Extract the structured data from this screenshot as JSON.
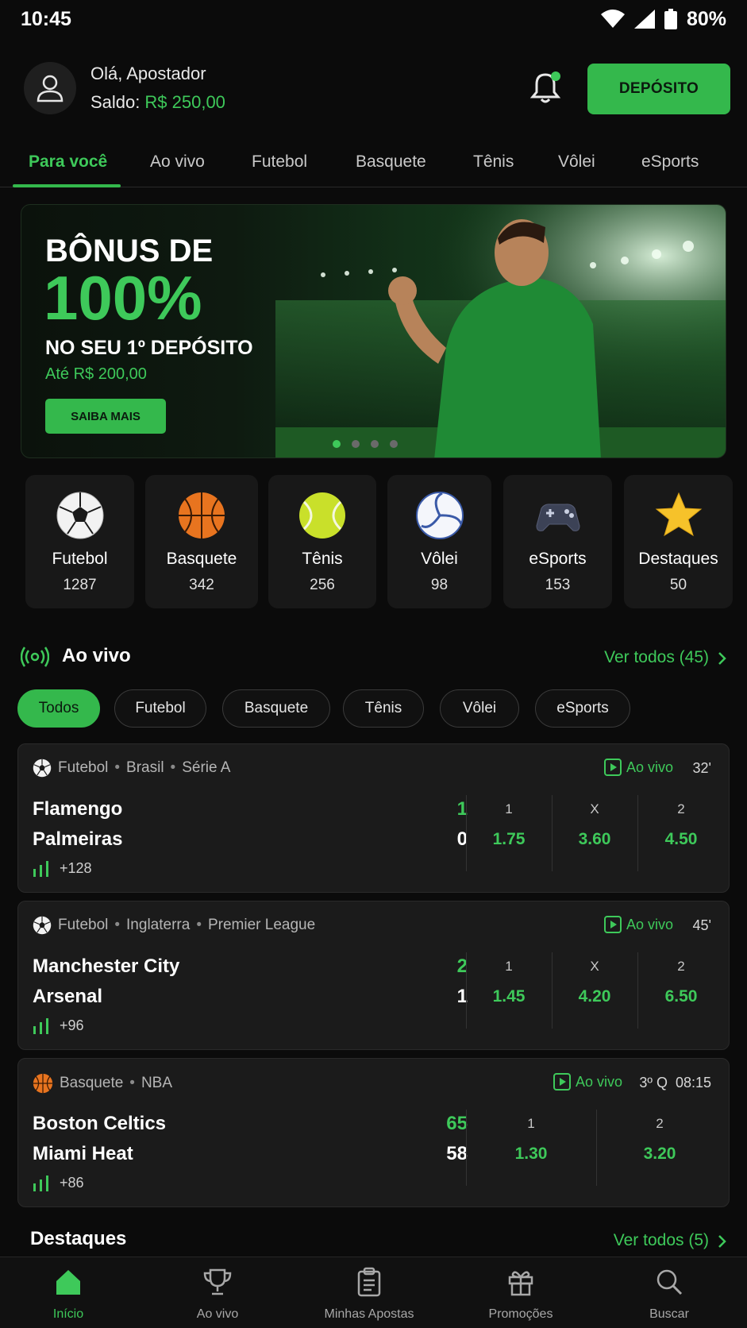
{
  "status_bar": {
    "time": "10:45",
    "battery": "80%"
  },
  "header": {
    "greeting": "Olá, Apostador",
    "balance_label": "Saldo:",
    "balance_value": "R$ 250,00",
    "deposit_label": "DEPÓSITO"
  },
  "tabs": [
    "Para você",
    "Ao vivo",
    "Futebol",
    "Basquete",
    "Tênis",
    "Vôlei",
    "eSports"
  ],
  "banner": {
    "line1": "BÔNUS DE",
    "line2": "100%",
    "line3": "NO SEU 1º DEPÓSITO",
    "sub": "Até R$ 200,00",
    "cta": "SAIBA MAIS",
    "slides": 4,
    "active_slide": 1
  },
  "sports": [
    {
      "name": "Futebol",
      "count": "1287",
      "icon": "soccer-ball-icon"
    },
    {
      "name": "Basquete",
      "count": "342",
      "icon": "basketball-icon"
    },
    {
      "name": "Tênis",
      "count": "256",
      "icon": "tennis-ball-icon"
    },
    {
      "name": "Vôlei",
      "count": "98",
      "icon": "volleyball-icon"
    },
    {
      "name": "eSports",
      "count": "153",
      "icon": "gamepad-icon"
    },
    {
      "name": "Destaques",
      "count": "50",
      "icon": "star-icon"
    }
  ],
  "live_section": {
    "title": "Ao vivo",
    "link": "Ver todos (45)"
  },
  "chips": [
    "Todos",
    "Futebol",
    "Basquete",
    "Tênis",
    "Vôlei",
    "eSports"
  ],
  "matches": [
    {
      "sport": "Futebol",
      "country": "Brasil",
      "league": "Série A",
      "live_label": "Ao vivo",
      "time": "32'",
      "home": "Flamengo",
      "away": "Palmeiras",
      "home_score": "1",
      "away_score": "0",
      "markets": "+128",
      "odds": [
        {
          "label": "1",
          "value": "1.75"
        },
        {
          "label": "X",
          "value": "3.60"
        },
        {
          "label": "2",
          "value": "4.50"
        }
      ]
    },
    {
      "sport": "Futebol",
      "country": "Inglaterra",
      "league": "Premier League",
      "live_label": "Ao vivo",
      "time": "45'",
      "home": "Manchester City",
      "away": "Arsenal",
      "home_score": "2",
      "away_score": "1",
      "markets": "+96",
      "odds": [
        {
          "label": "1",
          "value": "1.45"
        },
        {
          "label": "X",
          "value": "4.20"
        },
        {
          "label": "2",
          "value": "6.50"
        }
      ]
    },
    {
      "sport": "Basquete",
      "league": "NBA",
      "live_label": "Ao vivo",
      "time": "3º Q  08:15",
      "home": "Boston Celtics",
      "away": "Miami Heat",
      "home_score": "65",
      "away_score": "58",
      "markets": "+86",
      "odds": [
        {
          "label": "1",
          "value": "1.30"
        },
        {
          "label": "2",
          "value": "3.20"
        }
      ]
    }
  ],
  "featured_section": {
    "title": "Destaques",
    "link": "Ver todos (5)"
  },
  "bottom_nav": [
    "Início",
    "Ao vivo",
    "Minhas Apostas",
    "Promoções",
    "Buscar"
  ],
  "colors": {
    "accent": "#3ec95a",
    "background": "#0b0b0b",
    "card": "#1b1b1b"
  }
}
